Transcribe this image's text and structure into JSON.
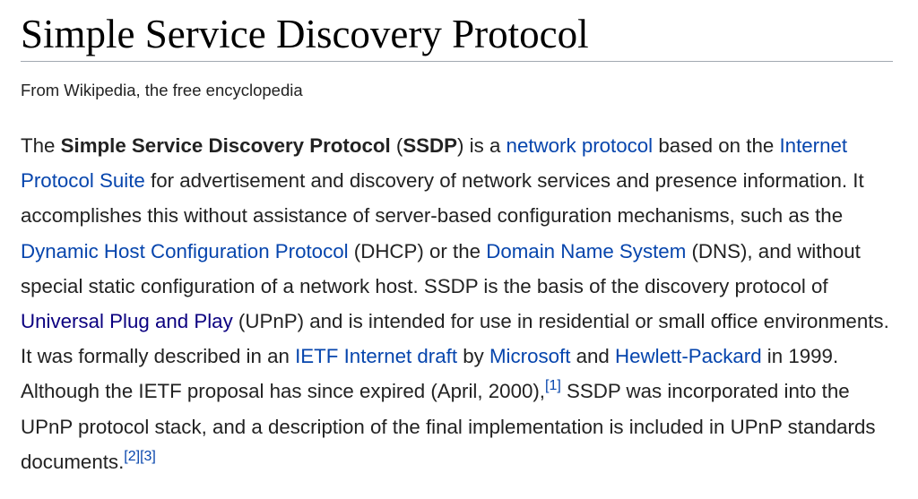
{
  "article": {
    "title": "Simple Service Discovery Protocol",
    "tagline": "From Wikipedia, the free encyclopedia"
  },
  "paragraph": {
    "t1": "The ",
    "bold_name": "Simple Service Discovery Protocol",
    "t2": " (",
    "bold_abbr": "SSDP",
    "t3": ") is a ",
    "link_network_protocol": "network protocol",
    "t4": " based on the ",
    "link_internet_protocol_suite": "Internet Protocol Suite",
    "t5": " for advertisement and discovery of network services and presence information. It accomplishes this without assistance of server-based configuration mechanisms, such as the ",
    "link_dhcp": "Dynamic Host Configuration Protocol",
    "t6": " (DHCP) or the ",
    "link_dns": "Domain Name System",
    "t7": " (DNS), and without special static configuration of a network host. SSDP is the basis of the discovery protocol of ",
    "link_upnp": "Universal Plug and Play",
    "t8": " (UPnP) and is intended for use in residential or small office environments. It was formally described in an ",
    "link_ietf_draft": "IETF Internet draft",
    "t9": " by ",
    "link_microsoft": "Microsoft",
    "t10": " and ",
    "link_hp": "Hewlett-Packard",
    "t11": " in 1999. Although the IETF proposal has since expired (April, 2000),",
    "ref1": "[1]",
    "t12": " SSDP was incorporated into the UPnP protocol stack, and a description of the final implementation is included in UPnP standards documents.",
    "ref2": "[2]",
    "ref3": "[3]"
  },
  "colors": {
    "link": "#0645ad",
    "visited_link": "#0b0080",
    "text": "#222222",
    "title_rule": "#a2a9b1"
  }
}
